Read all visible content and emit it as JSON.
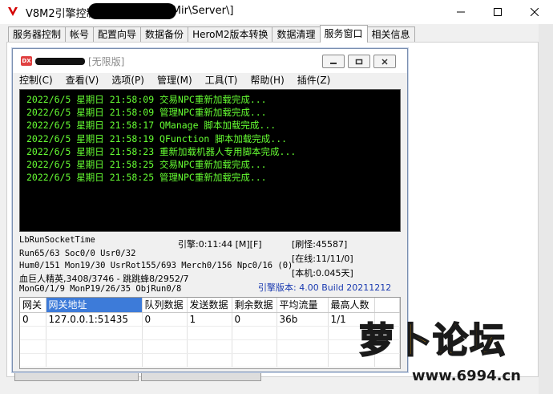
{
  "window": {
    "title": "V8M2引擎控制台",
    "title_suffix": "D:\\Mir\\Server\\]"
  },
  "tabs": [
    {
      "label": "服务器控制"
    },
    {
      "label": "帐号"
    },
    {
      "label": "配置向导"
    },
    {
      "label": "数据备份"
    },
    {
      "label": "HeroM2版本转换"
    },
    {
      "label": "数据清理"
    },
    {
      "label": "服务窗口"
    },
    {
      "label": "相关信息"
    }
  ],
  "inner": {
    "icon_text": "DX",
    "title": "[无限版]",
    "menu": [
      "控制(C)",
      "查看(V)",
      "选项(P)",
      "管理(M)",
      "工具(T)",
      "帮助(H)",
      "插件(Z)"
    ]
  },
  "console": [
    "2022/6/5 星期日 21:58:09 交易NPC重新加载完成...",
    "2022/6/5 星期日 21:58:09 管理NPC重新加载完成...",
    "2022/6/5 星期日 21:58:17 QManage 脚本加载完成...",
    "2022/6/5 星期日 21:58:19 QFunction 脚本加载完成...",
    "2022/6/5 星期日 21:58:23 重新加载机器人专用脚本完成...",
    "2022/6/5 星期日 21:58:25 交易NPC重新加载完成...",
    "2022/6/5 星期日 21:58:25 管理NPC重新加载完成..."
  ],
  "stats": {
    "socket_time": "LbRunSocketTime",
    "engine_time": "引擎:0:11:44 [M][F]",
    "refresh": "[刷怪:45587]",
    "run": "Run65/63 Soc0/0 Usr0/32",
    "online": "[在线:11/11/0]",
    "hum": "Hum0/151 Mon19/30 UsrRot155/693 Merch0/156 Npc0/16 (0)",
    "local": "[本机:0.045天]",
    "boss": "血巨人精英,3408/3746 - 跳跳蜂8/2952/7",
    "mongen": "MonG0/1/9 MonP19/26/35 ObjRun0/8",
    "version": "引擎版本: 4.00 Build 20211212"
  },
  "gate_table": {
    "headers": [
      "网关",
      "网关地址",
      "队列数据",
      "发送数据",
      "剩余数据",
      "平均流量",
      "最高人数"
    ],
    "rows": [
      [
        "0",
        "127.0.0.1:51435",
        "0",
        "1",
        "0",
        "36b",
        "1/1"
      ]
    ]
  },
  "watermark": {
    "text": "萝卜论坛",
    "url": "www.6994.cn"
  },
  "colors": {
    "console_text": "#66ff33",
    "version_text": "#1a3ab0",
    "selected_header": "#3d7bd9"
  }
}
